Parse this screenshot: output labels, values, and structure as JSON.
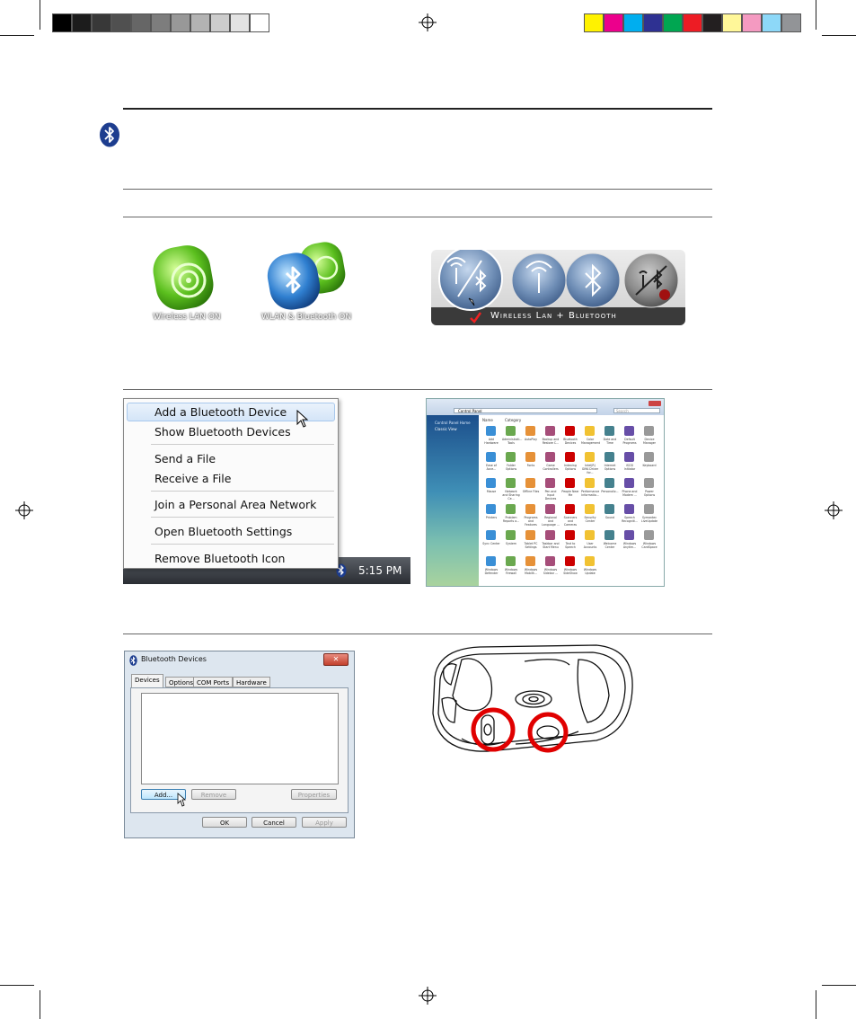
{
  "colors": {
    "gray_swatches": [
      "#000000",
      "#1c1c1c",
      "#383838",
      "#505050",
      "#666666",
      "#7d7d7d",
      "#989898",
      "#b3b3b3",
      "#cccccc",
      "#e3e3e3",
      "#ffffff"
    ],
    "color_swatches": [
      "#fff200",
      "#ec008c",
      "#00aeef",
      "#2e3192",
      "#00a651",
      "#ed1c24",
      "#231f20",
      "#fff799",
      "#f49ac1",
      "#8dd8f8",
      "#929497"
    ],
    "bluetooth_blue": "#1d3d8f",
    "highlight_red": "#e00000"
  },
  "figures": {
    "wireless_lan_caption": "Wireless LAN ON",
    "wlan_bt_caption": "WLAN & Bluetooth ON",
    "wireless_bar_caption": "Wireless Lan + Bluetooth"
  },
  "bt_menu": {
    "items": [
      "Add a Bluetooth Device",
      "Show Bluetooth Devices",
      "Send a File",
      "Receive a File",
      "Join a Personal Area Network",
      "Open Bluetooth Settings",
      "Remove Bluetooth Icon"
    ],
    "clock": "5:15 PM"
  },
  "control_panel": {
    "address": "Control Panel",
    "search_placeholder": "Search",
    "sidebar": [
      "Control Panel Home",
      "Classic View"
    ],
    "column_headers": [
      "Name",
      "Category"
    ],
    "items": [
      "Add Hardware",
      "Administrati... Tools",
      "AutoPlay",
      "Backup and Restore C...",
      "Bluetooth Devices",
      "Color Management",
      "Date and Time",
      "Default Programs",
      "Device Manager",
      "Ease of Acce...",
      "Folder Options",
      "Fonts",
      "Game Controllers",
      "Indexing Options",
      "Intel(R) GMA Driver for...",
      "Internet Options",
      "iSCSI Initiator",
      "Keyboard",
      "Mouse",
      "Network and Sharing Ce...",
      "Offline Files",
      "Pen and Input Devices",
      "People Near Me",
      "Performance Informatio...",
      "Personaliz...",
      "Phone and Modem ...",
      "Power Options",
      "Printers",
      "Problem Reports a...",
      "Programs and Features",
      "Regional and Language ...",
      "Scanners and Cameras",
      "Security Center",
      "Sound",
      "Speech Recogniti...",
      "Symantec LiveUpdate",
      "Sync Center",
      "System",
      "Tablet PC Settings",
      "Taskbar and Start Menu",
      "Text to Speech",
      "User Accounts",
      "Welcome Center",
      "Windows Anytim...",
      "Windows CardSpace",
      "Windows Defender",
      "Windows Firewall",
      "Windows Mobilit...",
      "Windows Sidebar ...",
      "Windows SideShow",
      "Windows Update"
    ]
  },
  "bt_dialog": {
    "title": "Bluetooth Devices",
    "tabs": [
      "Devices",
      "Options",
      "COM Ports",
      "Hardware"
    ],
    "add": "Add...",
    "remove": "Remove",
    "properties": "Properties",
    "ok": "OK",
    "cancel": "Cancel",
    "apply": "Apply"
  }
}
